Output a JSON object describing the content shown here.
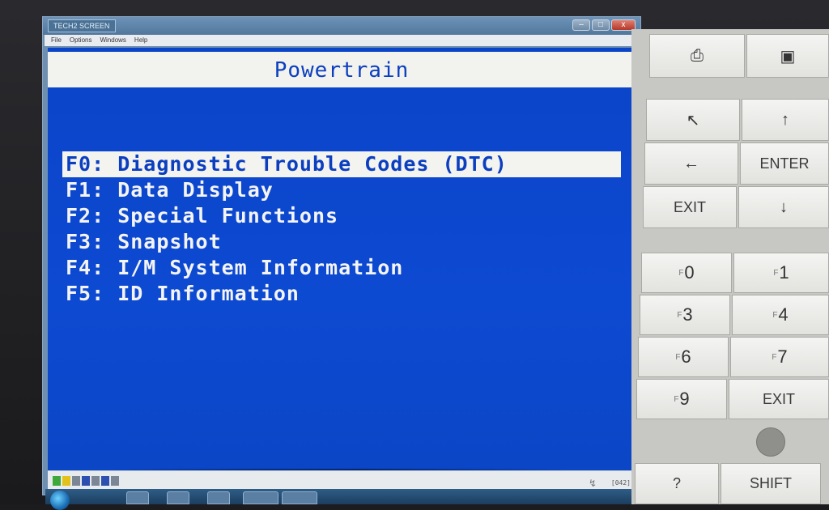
{
  "window": {
    "title": "TECH2 SCREEN",
    "menu": [
      "File",
      "Options",
      "Windows",
      "Help"
    ],
    "controls": {
      "minimize": "–",
      "maximize": "□",
      "close": "x"
    }
  },
  "screen": {
    "title": "Powertrain",
    "menu_items": [
      {
        "label": "F0: Diagnostic Trouble Codes (DTC)",
        "selected": true
      },
      {
        "label": "F1: Data Display",
        "selected": false
      },
      {
        "label": "F2: Special Functions",
        "selected": false
      },
      {
        "label": "F3: Snapshot",
        "selected": false
      },
      {
        "label": "F4: I/M System Information",
        "selected": false
      },
      {
        "label": "F5: ID Information",
        "selected": false
      }
    ]
  },
  "status_bar": {
    "code": "[042]",
    "signal_icon": "↯"
  },
  "keypad": {
    "arrow_up_left": "↖",
    "arrow_up": "↑",
    "arrow_left": "←",
    "arrow_down": "↓",
    "enter": "ENTER",
    "exit": "EXIT",
    "exit_2": "EXIT",
    "help": "?",
    "shift": "SHIFT",
    "f_prefix": "F",
    "f0": "0",
    "f1": "1",
    "f3": "3",
    "f4": "4",
    "f6": "6",
    "f7": "7",
    "f9": "9"
  }
}
